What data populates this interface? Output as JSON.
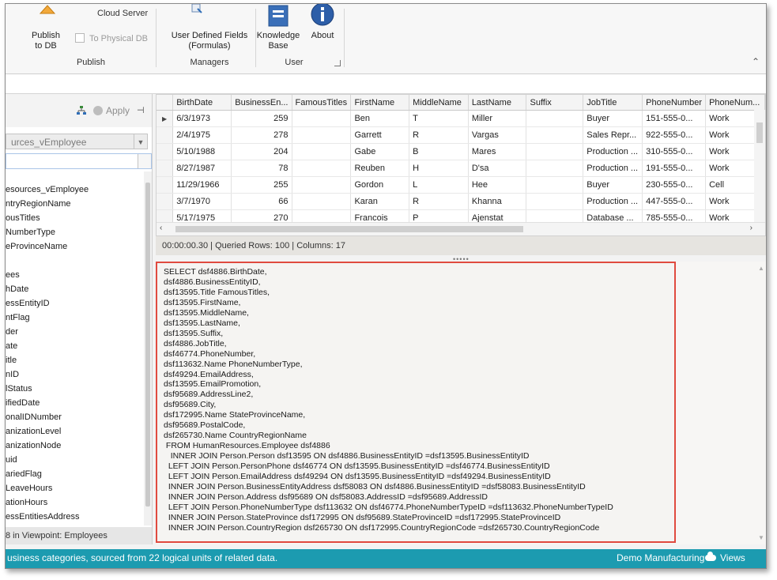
{
  "ribbon": {
    "cloud_server_label": "Cloud Server",
    "publish_to_db_label": "Publish\nto DB",
    "to_physical_db_label": "To Physical DB",
    "publish_group_label": "Publish",
    "user_defined_fields_label": "User Defined Fields\n(Formulas)",
    "managers_group_label": "Managers",
    "knowledge_base_label": "Knowledge\nBase",
    "about_label": "About",
    "user_group_label": "User"
  },
  "left_panel": {
    "apply_label": "Apply",
    "viewpoint_combo_value": "urces_vEmployee",
    "tree_items": [
      "esources_vEmployee",
      "ntryRegionName",
      "ousTitles",
      "NumberType",
      "eProvinceName",
      "",
      "ees",
      "hDate",
      "essEntityID",
      "ntFlag",
      "der",
      "ate",
      "itle",
      "nID",
      "lStatus",
      "ifiedDate",
      "onalIDNumber",
      "anizationLevel",
      "anizationNode",
      "uid",
      "ariedFlag",
      "LeaveHours",
      "ationHours",
      "essEntitiesAddress"
    ],
    "footer_text": "8 in Viewpoint: Employees"
  },
  "grid": {
    "columns": [
      "BirthDate",
      "BusinessEn...",
      "FamousTitles",
      "FirstName",
      "MiddleName",
      "LastName",
      "Suffix",
      "JobTitle",
      "PhoneNumber",
      "PhoneNum..."
    ],
    "rows": [
      [
        "6/3/1973",
        "259",
        "",
        "Ben",
        "T",
        "Miller",
        "",
        "Buyer",
        "151-555-0...",
        "Work"
      ],
      [
        "2/4/1975",
        "278",
        "",
        "Garrett",
        "R",
        "Vargas",
        "",
        "Sales Repr...",
        "922-555-0...",
        "Work"
      ],
      [
        "5/10/1988",
        "204",
        "",
        "Gabe",
        "B",
        "Mares",
        "",
        "Production ...",
        "310-555-0...",
        "Work"
      ],
      [
        "8/27/1987",
        "78",
        "",
        "Reuben",
        "H",
        "D'sa",
        "",
        "Production ...",
        "191-555-0...",
        "Work"
      ],
      [
        "11/29/1966",
        "255",
        "",
        "Gordon",
        "L",
        "Hee",
        "",
        "Buyer",
        "230-555-0...",
        "Cell"
      ],
      [
        "3/7/1970",
        "66",
        "",
        "Karan",
        "R",
        "Khanna",
        "",
        "Production ...",
        "447-555-0...",
        "Work"
      ],
      [
        "5/17/1975",
        "270",
        "",
        "Francois",
        "P",
        "Ajenstat",
        "",
        "Database ...",
        "785-555-0...",
        "Work"
      ]
    ],
    "status_text": "00:00:00.30 | Queried Rows: 100 | Columns: 17"
  },
  "sql": {
    "text": "SELECT dsf4886.BirthDate,\ndsf4886.BusinessEntityID,\ndsf13595.Title FamousTitles,\ndsf13595.FirstName,\ndsf13595.MiddleName,\ndsf13595.LastName,\ndsf13595.Suffix,\ndsf4886.JobTitle,\ndsf46774.PhoneNumber,\ndsf113632.Name PhoneNumberType,\ndsf49294.EmailAddress,\ndsf13595.EmailPromotion,\ndsf95689.AddressLine2,\ndsf95689.City,\ndsf172995.Name StateProvinceName,\ndsf95689.PostalCode,\ndsf265730.Name CountryRegionName\n FROM HumanResources.Employee dsf4886\n   INNER JOIN Person.Person dsf13595 ON dsf4886.BusinessEntityID =dsf13595.BusinessEntityID\n  LEFT JOIN Person.PersonPhone dsf46774 ON dsf13595.BusinessEntityID =dsf46774.BusinessEntityID\n  LEFT JOIN Person.EmailAddress dsf49294 ON dsf13595.BusinessEntityID =dsf49294.BusinessEntityID\n  INNER JOIN Person.BusinessEntityAddress dsf58083 ON dsf4886.BusinessEntityID =dsf58083.BusinessEntityID\n  INNER JOIN Person.Address dsf95689 ON dsf58083.AddressID =dsf95689.AddressID\n  LEFT JOIN Person.PhoneNumberType dsf113632 ON dsf46774.PhoneNumberTypeID =dsf113632.PhoneNumberTypeID\n  INNER JOIN Person.StateProvince dsf172995 ON dsf95689.StateProvinceID =dsf172995.StateProvinceID\n  INNER JOIN Person.CountryRegion dsf265730 ON dsf172995.CountryRegionCode =dsf265730.CountryRegionCode"
  },
  "statusbar": {
    "left_text": "usiness categories, sourced from 22 logical units of related data.",
    "model_name": "Demo Manufacturing",
    "views_label": "Views"
  },
  "colors": {
    "statusbar_bg": "#1c9bb0",
    "highlight_border": "#e04a3f"
  }
}
